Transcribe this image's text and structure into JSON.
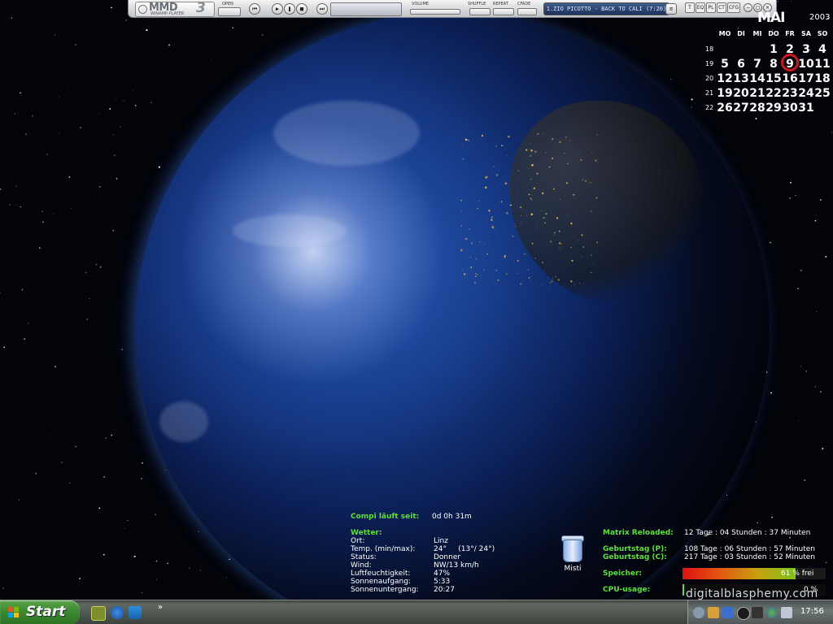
{
  "winamp": {
    "logo_main": "MMD",
    "logo_three": "3",
    "logo_sub": "WINAMP-PLAYER",
    "open_label": "OPEN",
    "volume_label": "VOLUME",
    "shuffle_label": "SHUFFLE",
    "repeat_label": "REPEAT",
    "cfade_label": "CFADE",
    "track": "1.ZIO PICOTTO - BACK TO CALI (7:20)",
    "top_buttons": [
      "T",
      "EQ",
      "PL",
      "CT",
      "CFG"
    ]
  },
  "calendar": {
    "month": "MAI",
    "year": "2003",
    "weekdays": [
      "MO",
      "DI",
      "MI",
      "DO",
      "FR",
      "SA",
      "SO"
    ],
    "weeks": [
      "18",
      "19",
      "20",
      "21",
      "22"
    ],
    "rows": [
      [
        "",
        "",
        "",
        "1",
        "2",
        "3",
        "4"
      ],
      [
        "5",
        "6",
        "7",
        "8",
        "9",
        "10",
        "11"
      ],
      [
        "12",
        "13",
        "14",
        "15",
        "16",
        "17",
        "18"
      ],
      [
        "19",
        "20",
        "21",
        "22",
        "23",
        "24",
        "25"
      ],
      [
        "26",
        "27",
        "28",
        "29",
        "30",
        "31",
        ""
      ]
    ],
    "today": "9"
  },
  "uptime": {
    "label": "Compi läuft seit:",
    "value": "0d 0h 31m"
  },
  "weather": {
    "title": "Wetter:",
    "rows": [
      {
        "label": "Ort:",
        "value": "Linz"
      },
      {
        "label": "Temp. (min/max):",
        "value": "24°     (13°/ 24°)"
      },
      {
        "label": "Status:",
        "value": "Donner"
      },
      {
        "label": "Wind:",
        "value": "NW/13 km/h"
      },
      {
        "label": "Luftfeuchtigkeit:",
        "value": "47%"
      },
      {
        "label": "Sonnenaufgang:",
        "value": "5:33"
      },
      {
        "label": "Sonnenuntergang:",
        "value": "20:27"
      }
    ]
  },
  "countdowns": {
    "matrix_label": "Matrix Reloaded:",
    "matrix_value": "12 Tage : 04 Stunden : 37 Minuten",
    "bday_p_label": "Geburtstag (P):",
    "bday_p_value": "108 Tage : 06 Stunden : 57 Minuten",
    "bday_c_label": "Geburtstag (C):",
    "bday_c_value": "217 Tage : 03 Stunden : 52 Minuten"
  },
  "memory": {
    "label": "Speicher:",
    "value_text": "61 % frei",
    "percent_free": 61
  },
  "cpu": {
    "label": "CPU-usage:",
    "value_text": "0 %",
    "percent": 0
  },
  "desktop": {
    "recycle_bin_label": "Misti"
  },
  "watermark": "digitalblasphemy.com",
  "taskbar": {
    "start_label": "Start",
    "chevron": "»",
    "clock": "17:56"
  },
  "colors": {
    "accent_green": "#5ee03a",
    "today_ring": "#d2141e",
    "start_green": "#3b8a30"
  }
}
